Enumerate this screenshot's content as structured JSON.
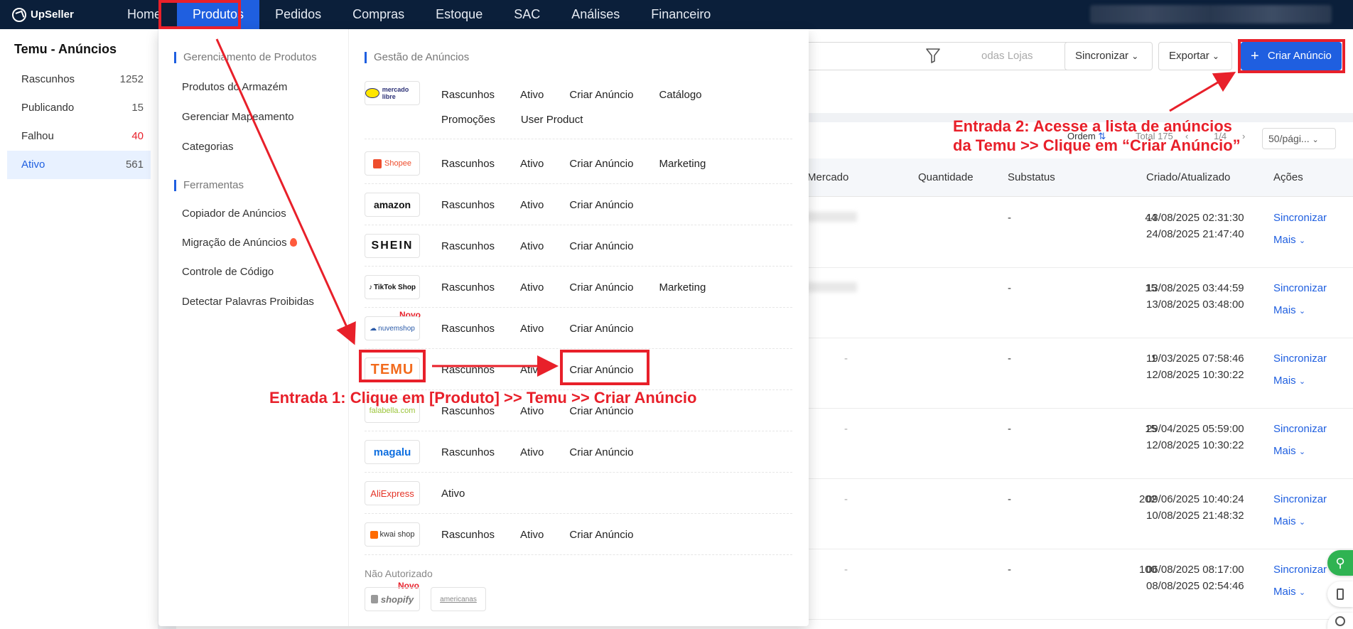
{
  "nav": {
    "logo": "UpSeller",
    "items": [
      "Home",
      "Produtos",
      "Pedidos",
      "Compras",
      "Estoque",
      "SAC",
      "Análises",
      "Financeiro"
    ],
    "active_index": 1
  },
  "sidebar": {
    "title": "Temu - Anúncios",
    "items": [
      {
        "label": "Rascunhos",
        "count": "1252"
      },
      {
        "label": "Publicando",
        "count": "15"
      },
      {
        "label": "Falhou",
        "count": "40"
      },
      {
        "label": "Ativo",
        "count": "561"
      }
    ],
    "active_index": 3
  },
  "toolbar": {
    "store_placeholder": "odas Lojas",
    "sync_label": "Sincronizar",
    "export_label": "Exportar",
    "create_label": "Criar Anúncio"
  },
  "pager": {
    "order_label": "Ordem",
    "total": "Total 175",
    "page": "1/4",
    "page_size": "50/pági..."
  },
  "table": {
    "headers": {
      "market": "Mercado",
      "qty": "Quantidade",
      "substatus": "Substatus",
      "created": "Criado/Atualizado",
      "actions": "Ações"
    },
    "rows": [
      {
        "qty": "44",
        "substatus": "-",
        "market": "",
        "created": "13/08/2025 02:31:30",
        "updated": "24/08/2025 21:47:40"
      },
      {
        "qty": "15",
        "substatus": "-",
        "market": "",
        "created": "13/08/2025 03:44:59",
        "updated": "13/08/2025 03:48:00"
      },
      {
        "qty": "1",
        "substatus": "-",
        "market": "-",
        "created": "19/03/2025 07:58:46",
        "updated": "12/08/2025 10:30:22"
      },
      {
        "qty": "15",
        "substatus": "-",
        "market": "-",
        "created": "29/04/2025 05:59:00",
        "updated": "12/08/2025 10:30:22"
      },
      {
        "qty": "202",
        "substatus": "-",
        "market": "-",
        "created": "09/06/2025 10:40:24",
        "updated": "10/08/2025 21:48:32"
      },
      {
        "qty": "100",
        "substatus": "-",
        "market": "-",
        "created": "06/08/2025 08:17:00",
        "updated": "08/08/2025 02:54:46"
      }
    ],
    "sync_link": "Sincronizar",
    "more_link": "Mais"
  },
  "menu": {
    "products_section": "Gerenciamento de Produtos",
    "products_links": [
      "Produtos do Armazém",
      "Gerenciar Mapeamento",
      "Categorias"
    ],
    "tools_section": "Ferramentas",
    "tools_links": [
      "Copiador de Anúncios",
      "Migração de Anúncios",
      "Controle de Código",
      "Detectar Palavras Proibidas"
    ],
    "listings_section": "Gestão de Anúncios",
    "marketplaces": [
      {
        "logo": "mercado libre",
        "actions": [
          "Rascunhos",
          "Ativo",
          "Criar Anúncio",
          "Catálogo",
          "Promoções",
          "User Product"
        ]
      },
      {
        "logo": "Shopee",
        "actions": [
          "Rascunhos",
          "Ativo",
          "Criar Anúncio",
          "Marketing"
        ]
      },
      {
        "logo": "amazon",
        "actions": [
          "Rascunhos",
          "Ativo",
          "Criar Anúncio"
        ]
      },
      {
        "logo": "SHEIN",
        "actions": [
          "Rascunhos",
          "Ativo",
          "Criar Anúncio"
        ]
      },
      {
        "logo": "TikTok Shop",
        "actions": [
          "Rascunhos",
          "Ativo",
          "Criar Anúncio",
          "Marketing"
        ]
      },
      {
        "logo": "nuvemshop",
        "actions": [
          "Rascunhos",
          "Ativo",
          "Criar Anúncio"
        ],
        "badge": "Novo"
      },
      {
        "logo": "TEMU",
        "actions": [
          "Rascunhos",
          "Ativo",
          "Criar Anúncio"
        ]
      },
      {
        "logo": "falabella.com",
        "actions": [
          "Rascunhos",
          "Ativo",
          "Criar Anúncio"
        ]
      },
      {
        "logo": "magalu",
        "actions": [
          "Rascunhos",
          "Ativo",
          "Criar Anúncio"
        ]
      },
      {
        "logo": "AliExpress",
        "actions": [
          "Ativo"
        ]
      },
      {
        "logo": "kwai shop",
        "actions": [
          "Rascunhos",
          "Ativo",
          "Criar Anúncio"
        ]
      }
    ],
    "unauthorized_title": "Não Autorizado",
    "unauthorized": [
      {
        "logo": "shopify",
        "badge": "Novo"
      },
      {
        "logo": "americanas"
      }
    ]
  },
  "annotations": {
    "entry1": "Entrada 1: Clique em [Produto] >> Temu >> Criar Anúncio",
    "entry2_line1": "Entrada 2: Acesse a lista de anúncios",
    "entry2_line2": "da Temu >> Clique em “Criar Anúncio”"
  },
  "colors": {
    "brand": "#1f5fe0",
    "nav_bg": "#0b1f3a",
    "annotation": "#e8202a",
    "temu": "#f26b1d"
  }
}
